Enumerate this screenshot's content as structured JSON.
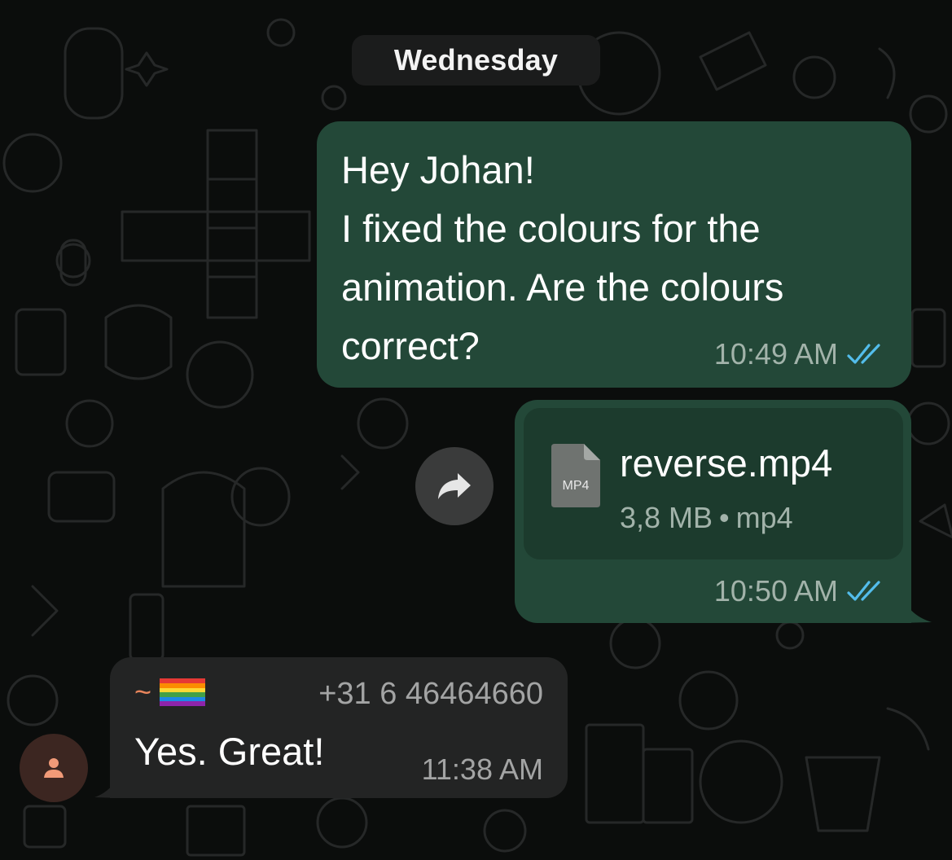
{
  "chat": {
    "date_divider": "Wednesday",
    "messages": [
      {
        "direction": "outgoing",
        "text": "Hey Johan!\nI fixed the colours for the animation. Are the colours correct?",
        "time": "10:49 AM",
        "status": "read"
      },
      {
        "direction": "outgoing",
        "attachment": {
          "type_label": "MP4",
          "filename": "reverse.mp4",
          "size": "3,8 MB",
          "separator": "•",
          "extension": "mp4"
        },
        "time": "10:50 AM",
        "status": "read"
      },
      {
        "direction": "incoming",
        "sender": {
          "name_prefix": "~",
          "name_emoji": "rainbow-flag",
          "phone": "+31 6 46464660"
        },
        "text": "Yes. Great!",
        "time": "11:38 AM"
      }
    ]
  },
  "icons": {
    "forward": "forward-arrow-icon",
    "read_receipt": "double-check-icon",
    "file": "file-document-icon",
    "avatar": "person-icon"
  },
  "colors": {
    "background": "#0b0d0c",
    "outgoing_bubble": "#234838",
    "incoming_bubble": "#232424",
    "read_tick": "#53bdeb",
    "sender_name": "#e8855c"
  }
}
